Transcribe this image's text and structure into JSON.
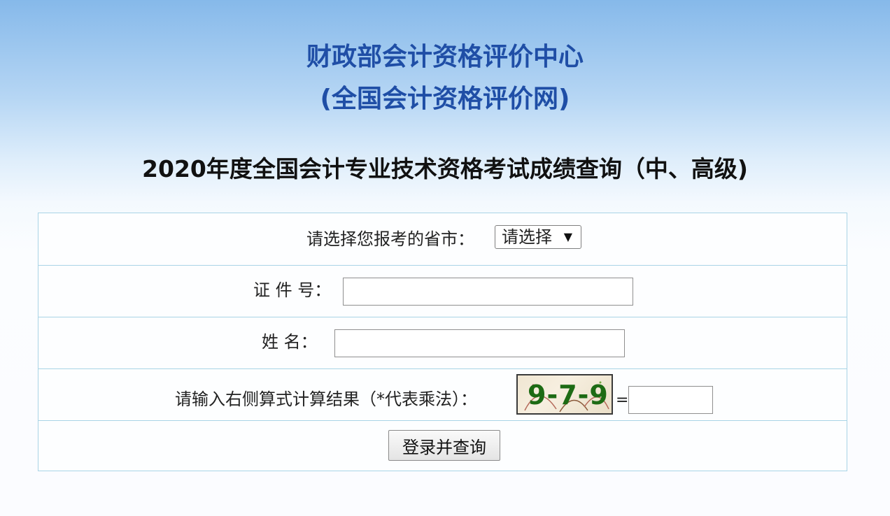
{
  "header": {
    "org_line1": "财政部会计资格评价中心",
    "org_line2": "(全国会计资格评价网)",
    "page_heading": "2020年度全国会计专业技术资格考试成绩查询（中、高级)"
  },
  "form": {
    "province_label": "请选择您报考的省市：",
    "province_selected": "请选择",
    "id_label": "证 件 号：",
    "id_value": "",
    "name_label": "姓  名：",
    "name_value": "",
    "captcha_label": "请输入右侧算式计算结果（*代表乘法）：",
    "captcha_text": "9-7-9",
    "equals_sign": "=",
    "captcha_answer": "",
    "submit_label": "登录并查询"
  }
}
